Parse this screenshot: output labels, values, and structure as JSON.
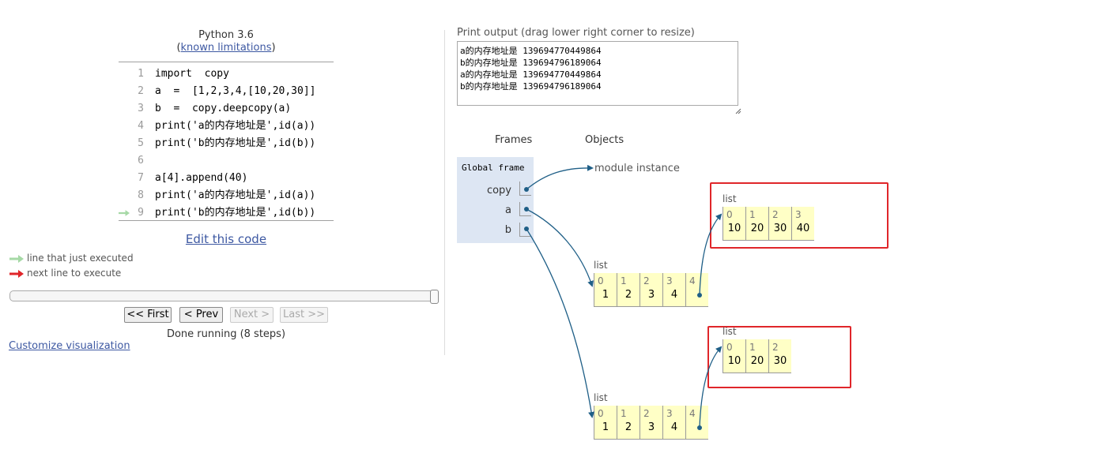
{
  "header": {
    "language": "Python 3.6",
    "limitations_open": "(",
    "limitations_link": "known limitations",
    "limitations_close": ")"
  },
  "code": {
    "lines": [
      {
        "num": "1",
        "text": "import  copy"
      },
      {
        "num": "2",
        "text": "a  =  [1,2,3,4,[10,20,30]]"
      },
      {
        "num": "3",
        "text": "b  =  copy.deepcopy(a)"
      },
      {
        "num": "4",
        "text": "print('a的内存地址是',id(a))"
      },
      {
        "num": "5",
        "text": "print('b的内存地址是',id(b))"
      },
      {
        "num": "6",
        "text": ""
      },
      {
        "num": "7",
        "text": "a[4].append(40)"
      },
      {
        "num": "8",
        "text": "print('a的内存地址是',id(a))"
      },
      {
        "num": "9",
        "text": "print('b的内存地址是',id(b))"
      }
    ],
    "current_line": "9"
  },
  "edit_link": "Edit this code",
  "legend": {
    "just_executed": "line that just executed",
    "next_line": "next line to execute",
    "just_executed_color": "#a6d9a6",
    "next_line_color": "#e0262a"
  },
  "controls": {
    "first": "<< First",
    "prev": "< Prev",
    "next": "Next >",
    "last": "Last >>",
    "status": "Done running (8 steps)",
    "slider_position": 1.0
  },
  "customize_link": "Customize visualization",
  "print_output": {
    "label": "Print output (drag lower right corner to resize)",
    "lines": [
      "a的内存地址是 139694770449864",
      "b的内存地址是 139694796189064",
      "a的内存地址是 139694770449864",
      "b的内存地址是 139694796189064"
    ]
  },
  "viz": {
    "frames_header": "Frames",
    "objects_header": "Objects",
    "global_frame_title": "Global frame",
    "variables": [
      "copy",
      "a",
      "b"
    ],
    "module_instance": "module instance",
    "list_label": "list",
    "lists": {
      "a_outer": {
        "indices": [
          "0",
          "1",
          "2",
          "3",
          "4"
        ],
        "values": [
          "1",
          "2",
          "3",
          "4",
          ""
        ]
      },
      "a_inner": {
        "indices": [
          "0",
          "1",
          "2",
          "3"
        ],
        "values": [
          "10",
          "20",
          "30",
          "40"
        ]
      },
      "b_outer": {
        "indices": [
          "0",
          "1",
          "2",
          "3",
          "4"
        ],
        "values": [
          "1",
          "2",
          "3",
          "4",
          ""
        ]
      },
      "b_inner": {
        "indices": [
          "0",
          "1",
          "2"
        ],
        "values": [
          "10",
          "20",
          "30"
        ]
      }
    },
    "arrow_color": "#1f5f87",
    "highlight_color": "#e0262a"
  }
}
